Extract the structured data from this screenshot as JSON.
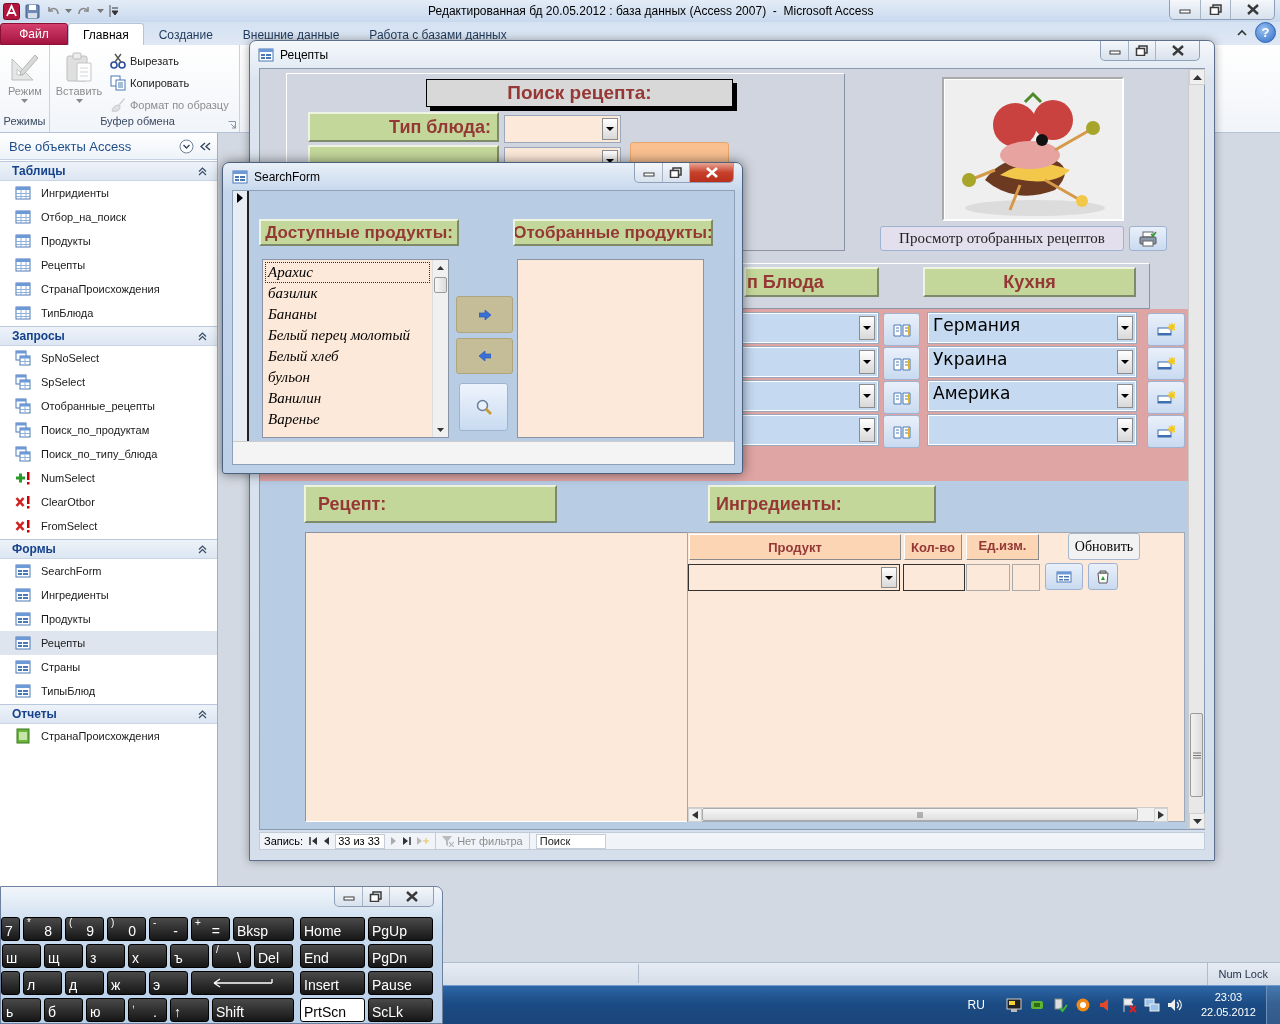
{
  "window": {
    "title": "Редактированная бд 20.05.2012 : база данных (Access 2007)  -  Microsoft Access"
  },
  "ribbon": {
    "file_tab": "Файл",
    "help_button": "?",
    "tabs": [
      {
        "label": "Главная",
        "selected": true
      },
      {
        "label": "Создание",
        "selected": false
      },
      {
        "label": "Внешние данные",
        "selected": false
      },
      {
        "label": "Работа с базами данных",
        "selected": false
      }
    ],
    "groups": [
      {
        "label": "Режимы",
        "commands": [
          {
            "kind": "large",
            "label": "Режим",
            "disabled": true
          }
        ]
      },
      {
        "label": "Буфер обмена",
        "commands": [
          {
            "kind": "large",
            "label": "Вставить",
            "disabled": true
          },
          {
            "kind": "small",
            "label": "Вырезать",
            "disabled": false
          },
          {
            "kind": "small",
            "label": "Копировать",
            "disabled": false
          },
          {
            "kind": "small",
            "label": "Формат по образцу",
            "disabled": true
          }
        ]
      }
    ]
  },
  "nav_pane": {
    "title": "Все объекты Access",
    "groups": [
      {
        "label": "Таблицы",
        "expanded": true,
        "items": [
          {
            "kind": "table",
            "label": "Ингридиенты",
            "selected": false
          },
          {
            "kind": "table",
            "label": "Отбор_на_поиск",
            "selected": false
          },
          {
            "kind": "table",
            "label": "Продукты",
            "selected": false
          },
          {
            "kind": "table",
            "label": "Рецепты",
            "selected": false
          },
          {
            "kind": "table",
            "label": "СтранаПроисхождения",
            "selected": false
          },
          {
            "kind": "table",
            "label": "ТипБлюда",
            "selected": false
          }
        ]
      },
      {
        "label": "Запросы",
        "expanded": true,
        "items": [
          {
            "kind": "query",
            "label": "SpNoSelect",
            "selected": false
          },
          {
            "kind": "query",
            "label": "SpSelect",
            "selected": false
          },
          {
            "kind": "query",
            "label": "Отобранные_рецепты",
            "selected": false
          },
          {
            "kind": "query",
            "label": "Поиск_по_продуктам",
            "selected": false
          },
          {
            "kind": "query",
            "label": "Поиск_по_типу_блюда",
            "selected": false
          },
          {
            "kind": "append",
            "label": "NumSelect",
            "selected": false
          },
          {
            "kind": "delete",
            "label": "ClearOtbor",
            "selected": false
          },
          {
            "kind": "delete",
            "label": "FromSelect",
            "selected": false
          }
        ]
      },
      {
        "label": "Формы",
        "expanded": true,
        "items": [
          {
            "kind": "form",
            "label": "SearchForm",
            "selected": false
          },
          {
            "kind": "form",
            "label": "Ингредиенты",
            "selected": false
          },
          {
            "kind": "form",
            "label": "Продукты",
            "selected": false
          },
          {
            "kind": "form",
            "label": "Рецепты",
            "selected": true
          },
          {
            "kind": "form",
            "label": "Страны",
            "selected": false
          },
          {
            "kind": "form",
            "label": "ТипыБлюд",
            "selected": false
          }
        ]
      },
      {
        "label": "Отчеты",
        "expanded": true,
        "items": [
          {
            "kind": "report",
            "label": "СтранаПроисхождения",
            "selected": false
          }
        ]
      }
    ]
  },
  "recipe_form": {
    "title": "Рецепты",
    "search_title": "Поиск рецепта:",
    "filters": [
      {
        "kind": "labeled",
        "label": "Тип блюда:"
      },
      {
        "kind": "covered"
      }
    ],
    "view_button": "Просмотр отобранных рецептов",
    "columns": [
      "п Блюда",
      "Кухня"
    ],
    "rows": [
      {
        "country": "Германия"
      },
      {
        "country": "Украина"
      },
      {
        "country": "Америка"
      }
    ],
    "new_row": true,
    "recipe_label": "Рецепт:",
    "ingredients_label": "Ингредиенты:",
    "subform": {
      "columns": [
        "Продукт",
        "Кол-во",
        "Ед.изм."
      ],
      "refresh_button": "Обновить"
    },
    "navigation": {
      "label": "Запись:",
      "position": "33 из 33",
      "filter": "Нет фильтра",
      "search_placeholder": "Поиск"
    }
  },
  "search_form": {
    "title": "SearchForm",
    "available_label": "Доступные продукты:",
    "selected_label": "Отобранные продукты:",
    "available": [
      {
        "label": "Арахис",
        "selected": true
      },
      {
        "label": "базилик",
        "selected": false
      },
      {
        "label": "Бананы",
        "selected": false
      },
      {
        "label": "Белый перец молотый",
        "selected": false
      },
      {
        "label": "Белый хлеб",
        "selected": false
      },
      {
        "label": "бульон",
        "selected": false
      },
      {
        "label": "Ванилин",
        "selected": false
      },
      {
        "label": "Варенье",
        "selected": false
      }
    ]
  },
  "keyboard": {
    "rows": [
      [
        {
          "kind": "char",
          "label": "7",
          "pressed": false
        },
        {
          "kind": "char",
          "shift": "*",
          "label": "8",
          "pressed": false
        },
        {
          "kind": "char",
          "shift": "(",
          "label": "9",
          "pressed": false
        },
        {
          "kind": "char",
          "shift": ")",
          "label": "0",
          "pressed": false
        },
        {
          "kind": "char",
          "shift": "-",
          "label": "-",
          "pressed": false
        },
        {
          "kind": "char",
          "shift": "+",
          "label": "=",
          "pressed": false
        },
        {
          "kind": "wide",
          "label": "Bksp",
          "pressed": false
        },
        {
          "kind": "nav",
          "label": "Home",
          "pressed": false
        },
        {
          "kind": "nav",
          "label": "PgUp",
          "pressed": false
        }
      ],
      [
        {
          "kind": "char",
          "label": "ш",
          "pressed": false
        },
        {
          "kind": "char",
          "label": "щ",
          "pressed": false
        },
        {
          "kind": "char",
          "label": "з",
          "pressed": false
        },
        {
          "kind": "char",
          "label": "х",
          "pressed": false
        },
        {
          "kind": "char",
          "label": "ъ",
          "pressed": false
        },
        {
          "kind": "char",
          "shift": "/",
          "label": "\\",
          "pressed": false
        },
        {
          "kind": "char",
          "label": "Del",
          "pressed": false
        },
        {
          "kind": "nav",
          "label": "End",
          "pressed": false
        },
        {
          "kind": "nav",
          "label": "PgDn",
          "pressed": false
        }
      ],
      [
        {
          "kind": "blank",
          "pressed": false
        },
        {
          "kind": "char",
          "label": "л",
          "pressed": false
        },
        {
          "kind": "char",
          "label": "д",
          "pressed": false
        },
        {
          "kind": "char",
          "label": "ж",
          "pressed": false
        },
        {
          "kind": "char",
          "label": "э",
          "pressed": false
        },
        {
          "kind": "enter",
          "pressed": false
        },
        {
          "kind": "nav",
          "label": "Insert",
          "pressed": false
        },
        {
          "kind": "nav",
          "label": "Pause",
          "pressed": false
        }
      ],
      [
        {
          "kind": "char",
          "label": "ь",
          "pressed": false
        },
        {
          "kind": "char",
          "label": "б",
          "pressed": false
        },
        {
          "kind": "char",
          "label": "ю",
          "pressed": false
        },
        {
          "kind": "char",
          "shift": ",",
          "label": ".",
          "pressed": false
        },
        {
          "kind": "char",
          "label": "↑",
          "pressed": false
        },
        {
          "kind": "wide",
          "label": "Shift",
          "pressed": false
        },
        {
          "kind": "nav",
          "label": "PrtScn",
          "pressed": true
        },
        {
          "kind": "nav",
          "label": "ScLk",
          "pressed": false
        }
      ]
    ]
  },
  "status_bar": {
    "indicator": "Num Lock"
  },
  "taskbar": {
    "language": "RU",
    "time": "23:03",
    "date": "22.05.2012"
  }
}
